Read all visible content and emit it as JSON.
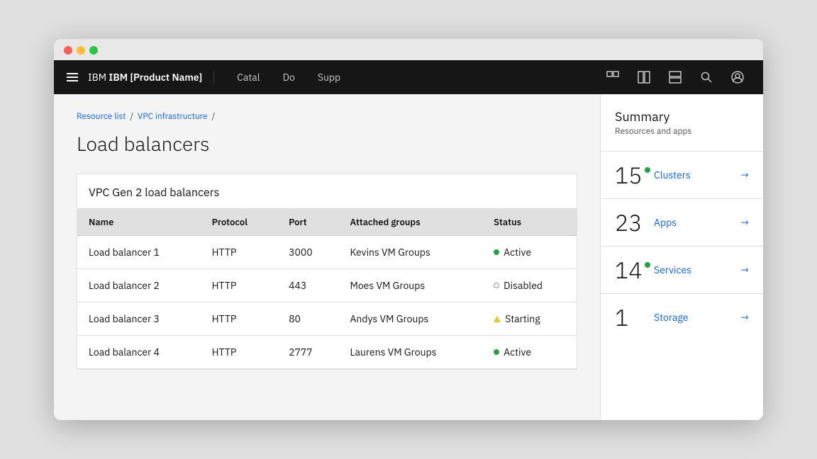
{
  "browser": {
    "dots": [
      "red",
      "yellow",
      "green"
    ]
  },
  "topnav": {
    "brand": "IBM [Product Name]",
    "links": [
      "Catal",
      "Do",
      "Supp"
    ],
    "icons": [
      "panels-icon",
      "panels2-icon",
      "panels3-icon",
      "search-icon",
      "user-icon"
    ]
  },
  "breadcrumb": {
    "items": [
      "Resource list",
      "VPC infrastructure"
    ],
    "current": ""
  },
  "page": {
    "title": "Load balancers"
  },
  "section": {
    "title": "VPC Gen 2 load balancers"
  },
  "table": {
    "columns": [
      "Name",
      "Protocol",
      "Port",
      "Attached groups",
      "Status"
    ],
    "rows": [
      {
        "name": "Load balancer 1",
        "protocol": "HTTP",
        "port": "3000",
        "attached_groups": "Kevins VM Groups",
        "status": "Active",
        "status_type": "active"
      },
      {
        "name": "Load balancer 2",
        "protocol": "HTTP",
        "port": "443",
        "attached_groups": "Moes VM Groups",
        "status": "Disabled",
        "status_type": "disabled"
      },
      {
        "name": "Load balancer 3",
        "protocol": "HTTP",
        "port": "80",
        "attached_groups": "Andys VM Groups",
        "status": "Starting",
        "status_type": "starting"
      },
      {
        "name": "Load balancer 4",
        "protocol": "HTTP",
        "port": "2777",
        "attached_groups": "Laurens VM Groups",
        "status": "Active",
        "status_type": "active"
      }
    ]
  },
  "summary": {
    "title": "Summary",
    "subtitle": "Resources and apps",
    "items": [
      {
        "count": "15",
        "has_dot": true,
        "label": "Clusters",
        "count_id": "clusters-count"
      },
      {
        "count": "23",
        "has_dot": false,
        "label": "Apps",
        "count_id": "apps-count"
      },
      {
        "count": "14",
        "has_dot": true,
        "label": "Services",
        "count_id": "services-count"
      },
      {
        "count": "1",
        "has_dot": false,
        "label": "Storage",
        "count_id": "storage-count"
      }
    ]
  }
}
